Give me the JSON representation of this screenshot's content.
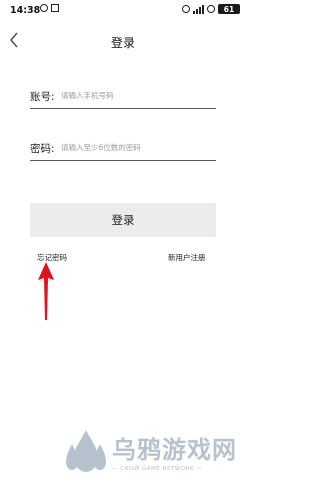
{
  "status_bar": {
    "time": "14:38",
    "battery": "61"
  },
  "nav": {
    "title": "登录"
  },
  "form": {
    "account_label": "账号:",
    "account_placeholder": "请输入手机号码",
    "password_label": "密码:",
    "password_placeholder": "请输入至少6位数的密码",
    "login_button": "登录"
  },
  "links": {
    "forgot_password": "忘记密码",
    "register": "新用户注册"
  },
  "watermark": {
    "brand": "乌鸦游戏网",
    "tagline": "— CROW GAME NETWORK —"
  },
  "colors": {
    "arrow": "#e0121b",
    "button_bg": "#ececec",
    "watermark": "#b6c3cf"
  }
}
